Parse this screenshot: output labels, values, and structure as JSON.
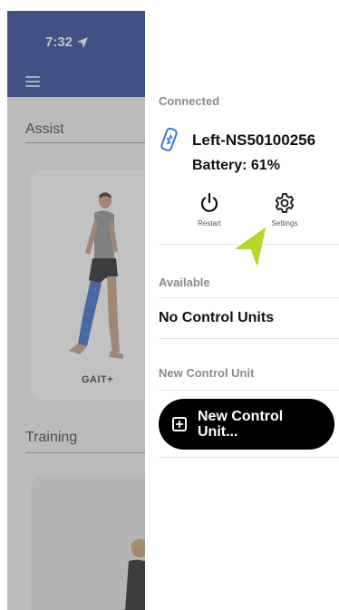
{
  "status_bar": {
    "time": "7:32"
  },
  "background": {
    "menu_icon": "hamburger-icon",
    "assist_title": "Assist",
    "assist_card_label": "GAIT+",
    "training_title": "Training"
  },
  "drawer": {
    "connected_header": "Connected",
    "device": {
      "name": "Left-NS50100256",
      "battery": "Battery: 61%",
      "icon": "bluetooth-device-icon"
    },
    "actions": [
      {
        "label": "Restart",
        "icon": "restart-icon"
      },
      {
        "label": "Settings",
        "icon": "gear-icon"
      }
    ],
    "available_header": "Available",
    "no_units": "No Control Units",
    "new_unit_header": "New Control Unit",
    "new_unit_button": "New Control Unit..."
  },
  "colors": {
    "header_blue": "#1e3f93",
    "pointer_green": "#b5d82a",
    "button_black": "#000000"
  }
}
